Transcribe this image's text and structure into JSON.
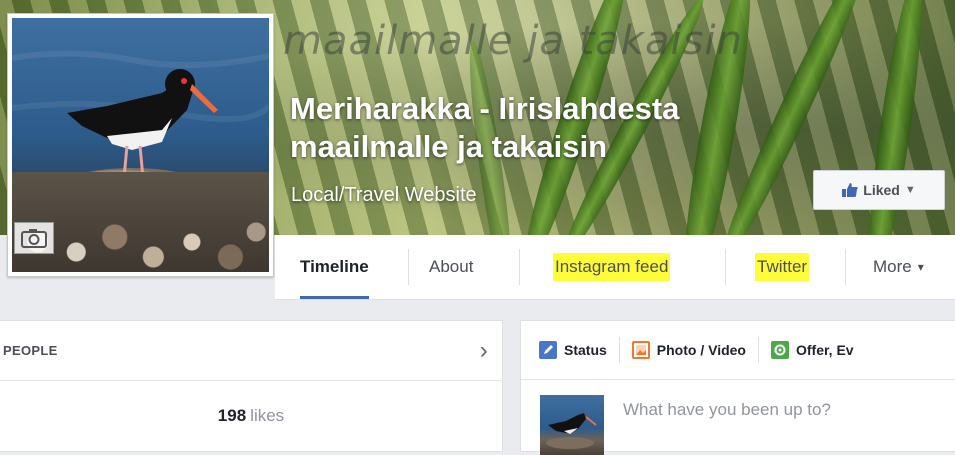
{
  "cover": {
    "script_text": "maailmalle ja takaisin",
    "title": "Meriharakka - Iirislahdesta maailmalle ja takaisin",
    "category": "Local/Travel Website",
    "liked_label": "Liked",
    "liked_icon": "thumbs-up-icon"
  },
  "nav": {
    "tabs": [
      {
        "label": "Timeline",
        "active": true
      },
      {
        "label": "About"
      },
      {
        "label": "Instagram feed",
        "highlighted": true
      },
      {
        "label": "Twitter",
        "highlighted": true
      },
      {
        "label": "More"
      }
    ],
    "more_caret": "▾",
    "highlight_color": "#fffd3a",
    "active_underline_color": "#4267b2"
  },
  "left_panel": {
    "section_label": "PEOPLE",
    "chevron": "›",
    "likes_count": "198",
    "likes_suffix": "likes"
  },
  "composer": {
    "tabs": [
      {
        "label": "Status",
        "icon": "pencil-icon",
        "color": "#4a76c8"
      },
      {
        "label": "Photo / Video",
        "icon": "photo-icon",
        "color": "#f0782a"
      },
      {
        "label": "Offer, Ev",
        "icon": "offer-icon",
        "color": "#4ca84b"
      }
    ],
    "placeholder": "What have you been up to?"
  }
}
